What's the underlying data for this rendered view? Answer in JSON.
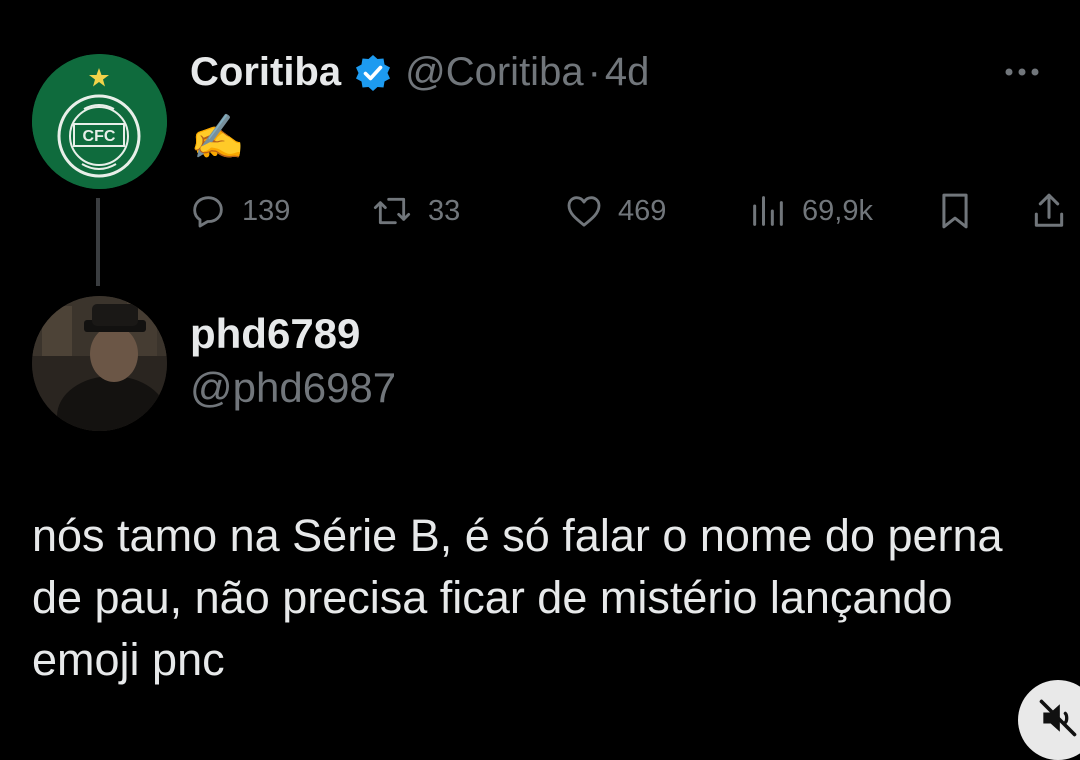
{
  "tweet": {
    "author_name": "Coritiba",
    "author_handle": "@Coritiba",
    "separator": "·",
    "time": "4d",
    "text": "✍️",
    "verified": true,
    "avatar_icon": "coritiba-crest-icon",
    "avatar_text": "CFC",
    "stats": {
      "replies": "139",
      "retweets": "33",
      "likes": "469",
      "views": "69,9k"
    }
  },
  "reply": {
    "author_name": "phd6789",
    "author_handle": "@phd6987",
    "text": "nós tamo na Série B, é só falar o nome do perna de pau, não precisa ficar de mistério lançando emoji pnc",
    "avatar_icon": "user-photo-avatar"
  },
  "icons": {
    "more": "more-icon",
    "reply": "reply-icon",
    "retweet": "retweet-icon",
    "like": "heart-icon",
    "views": "views-icon",
    "bookmark": "bookmark-icon",
    "share": "share-icon",
    "mute": "mute-icon",
    "verified": "verified-badge-icon"
  },
  "colors": {
    "background": "#000000",
    "primary_text": "#e7e9ea",
    "secondary_text": "#71767b",
    "verified_blue": "#1d9bf0",
    "coritiba_green": "#0f6b3d"
  }
}
